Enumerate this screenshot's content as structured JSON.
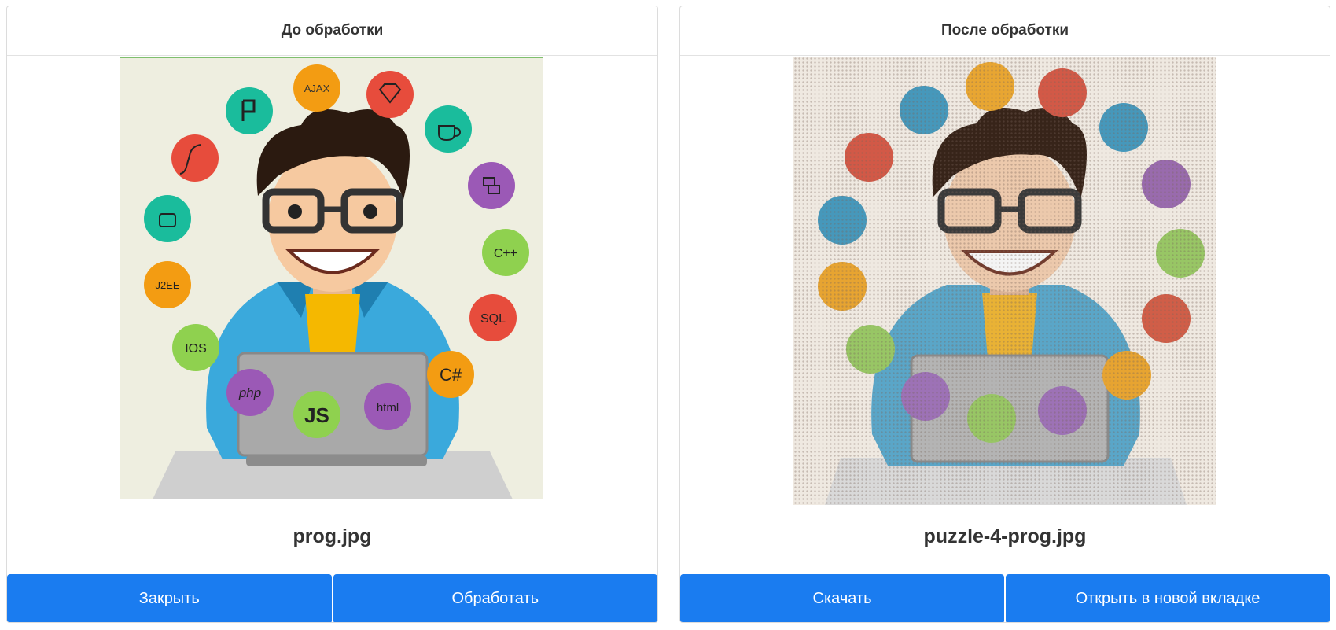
{
  "before": {
    "header": "До обработки",
    "filename": "prog.jpg",
    "close_label": "Закрыть",
    "process_label": "Обработать"
  },
  "after": {
    "header": "После обработки",
    "filename": "puzzle-4-prog.jpg",
    "download_label": "Скачать",
    "open_tab_label": "Открыть в новой вкладке"
  },
  "illustration": {
    "bubbles": [
      {
        "label": "AJAX",
        "color": "#f39c12"
      },
      {
        "label": "",
        "color": "#e74c3c",
        "icon": "gem-icon"
      },
      {
        "label": "",
        "color": "#1abc9c",
        "icon": "coffee-icon"
      },
      {
        "label": "",
        "color": "#9b59b6",
        "icon": "python-icon"
      },
      {
        "label": "C++",
        "color": "#8fd14f"
      },
      {
        "label": "SQL",
        "color": "#e74c3c"
      },
      {
        "label": "C#",
        "color": "#f39c12"
      },
      {
        "label": "html",
        "color": "#9b59b6"
      },
      {
        "label": "JS",
        "color": "#8fd14f"
      },
      {
        "label": "php",
        "color": "#9b59b6"
      },
      {
        "label": "IOS",
        "color": "#8fd14f"
      },
      {
        "label": "J2EE",
        "color": "#f39c12"
      },
      {
        "label": "",
        "color": "#1abc9c",
        "icon": "android-icon"
      },
      {
        "label": "",
        "color": "#e74c3c",
        "icon": "flash-icon"
      },
      {
        "label": "",
        "color": "#1abc9c",
        "icon": "pivotal-icon"
      }
    ]
  },
  "colors": {
    "button": "#1a7cf0",
    "jacket": "#3aa9dc",
    "shirt": "#f5b800",
    "hair": "#2b1a10",
    "skin": "#f6c9a0"
  }
}
